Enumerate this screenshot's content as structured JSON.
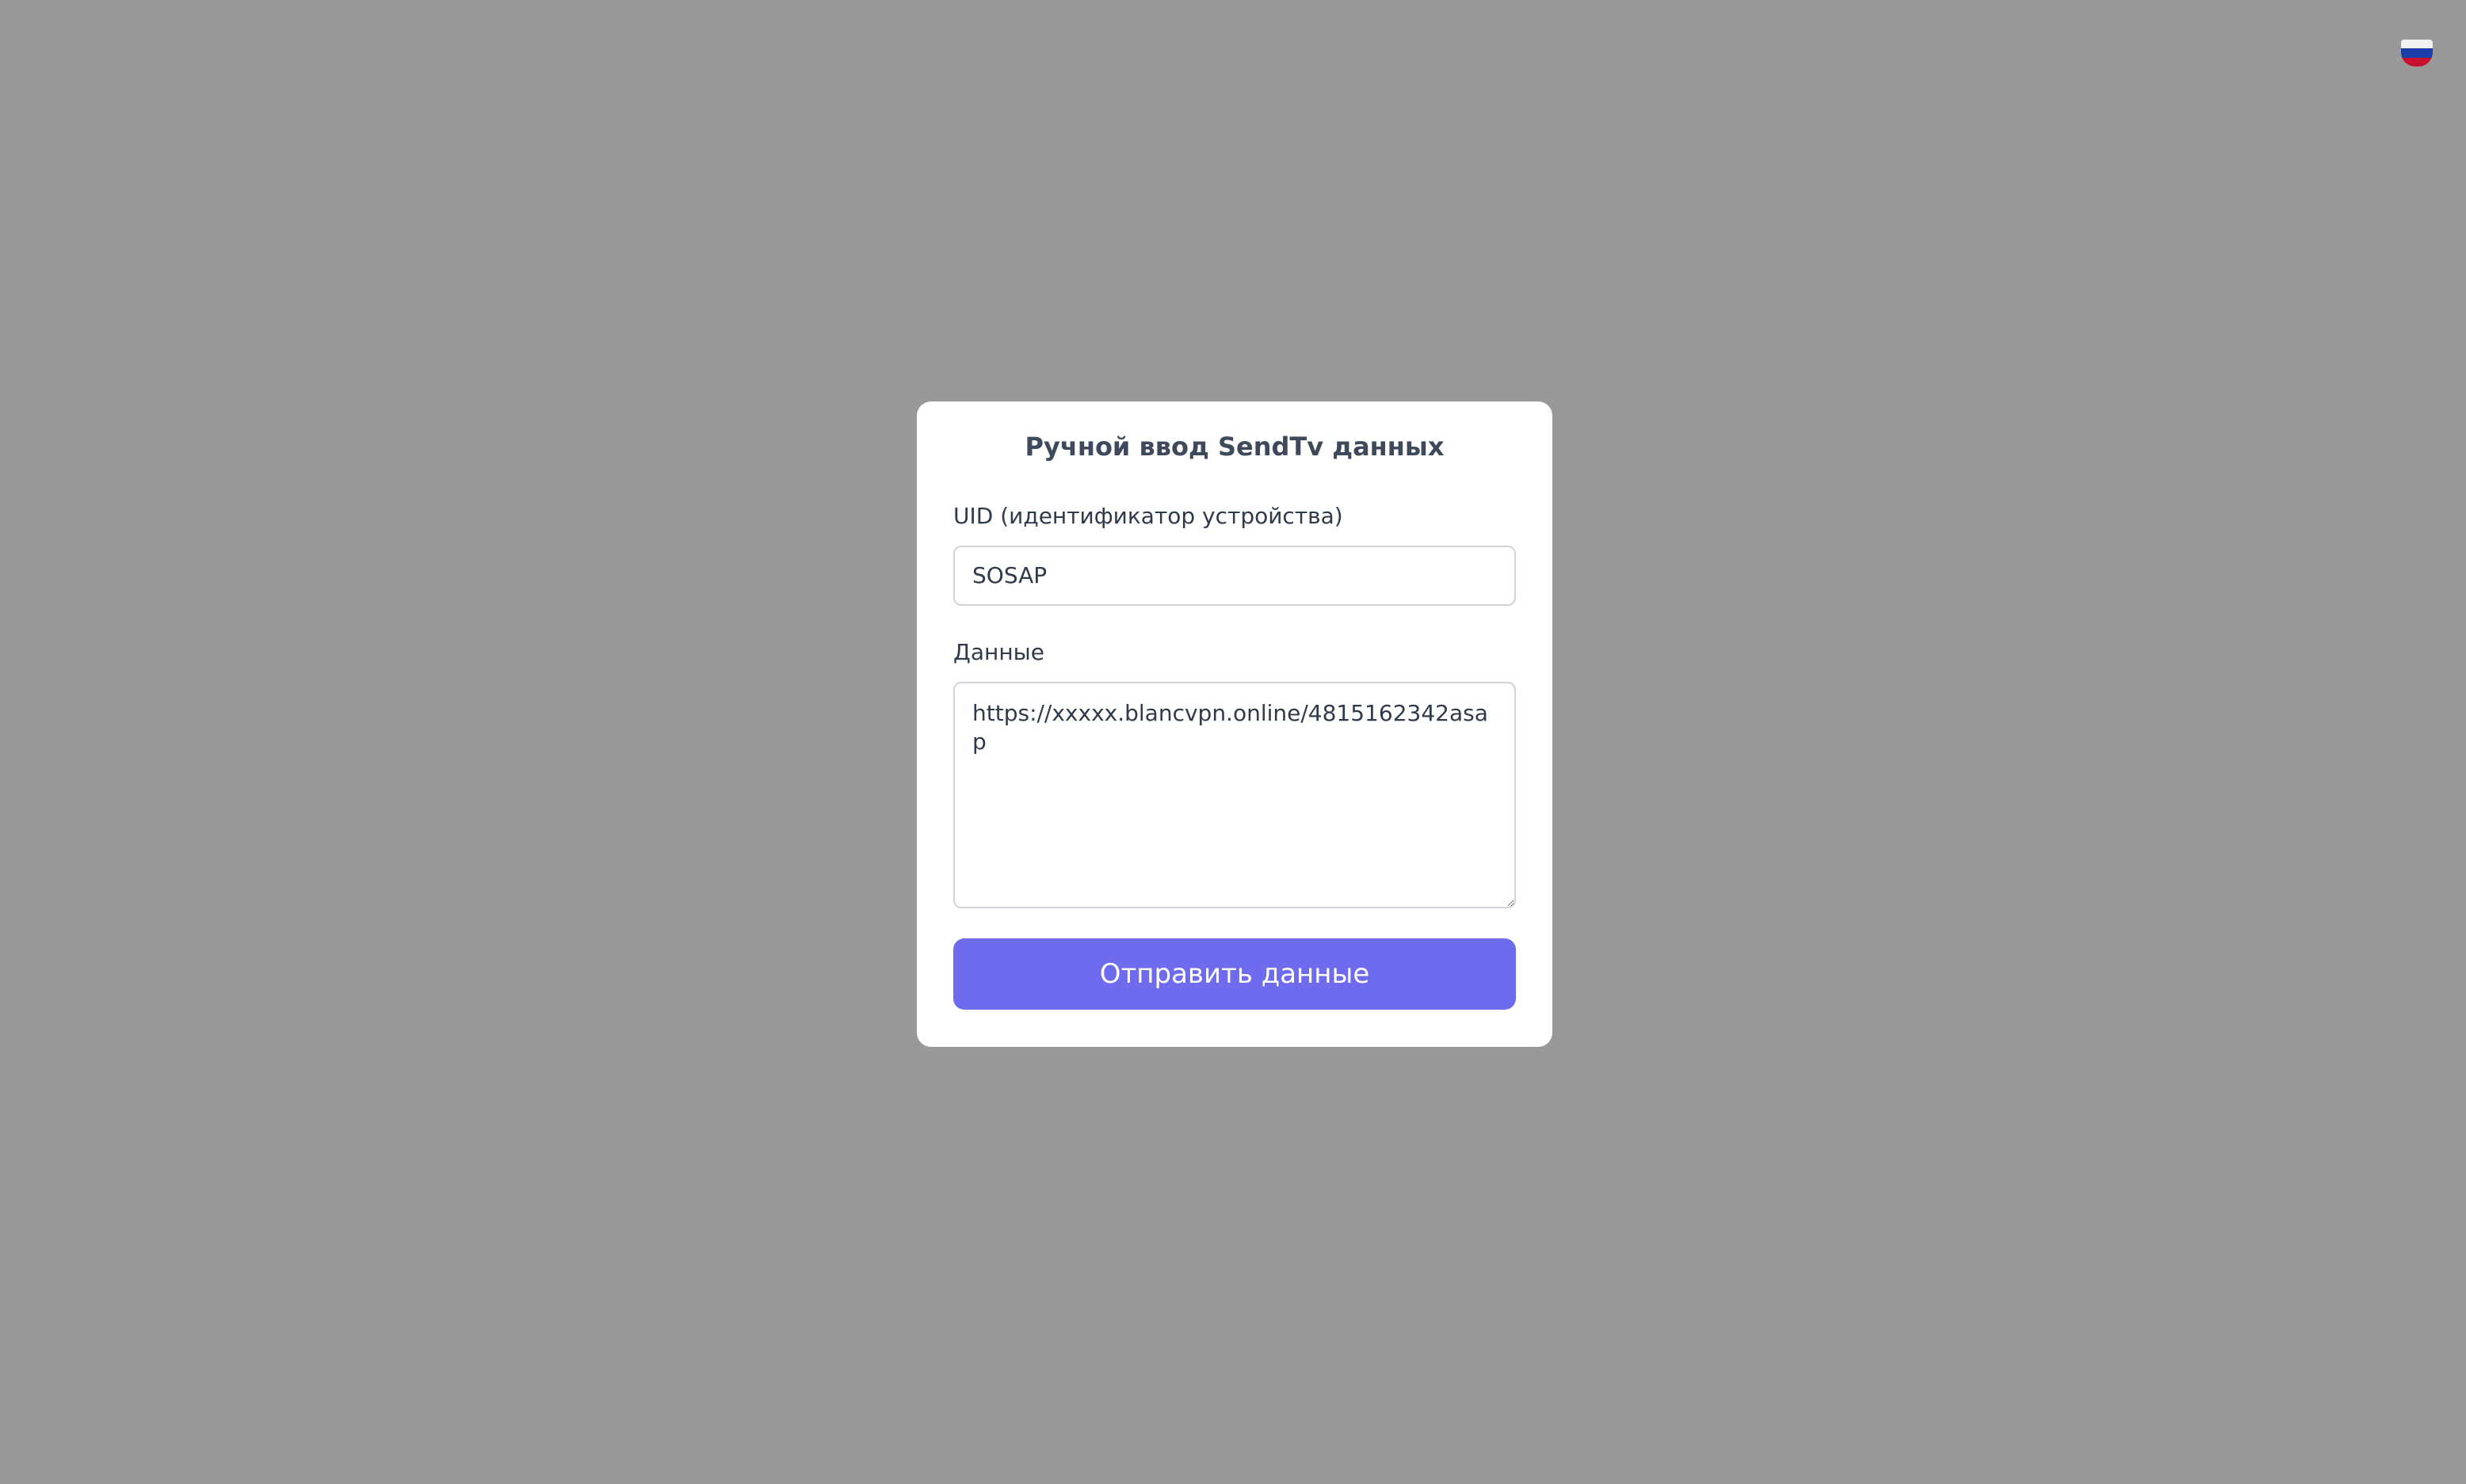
{
  "header": {
    "language_icon": "russia-flag-icon",
    "flag_colors": [
      "#f2f2f2",
      "#1c3ea8",
      "#c8102e"
    ]
  },
  "form": {
    "title": "Ручной ввод SendTv данных",
    "uid_label": "UID (идентификатор устройства)",
    "uid_value": "SOSAP",
    "data_label": "Данные",
    "data_value": "https://xxxxx.blancvpn.online/4815162342asap",
    "submit_label": "Отправить данные"
  },
  "colors": {
    "backdrop": "#999999",
    "card": "#ffffff",
    "accent": "#6e6bef",
    "title_text": "#3e4a5c"
  }
}
